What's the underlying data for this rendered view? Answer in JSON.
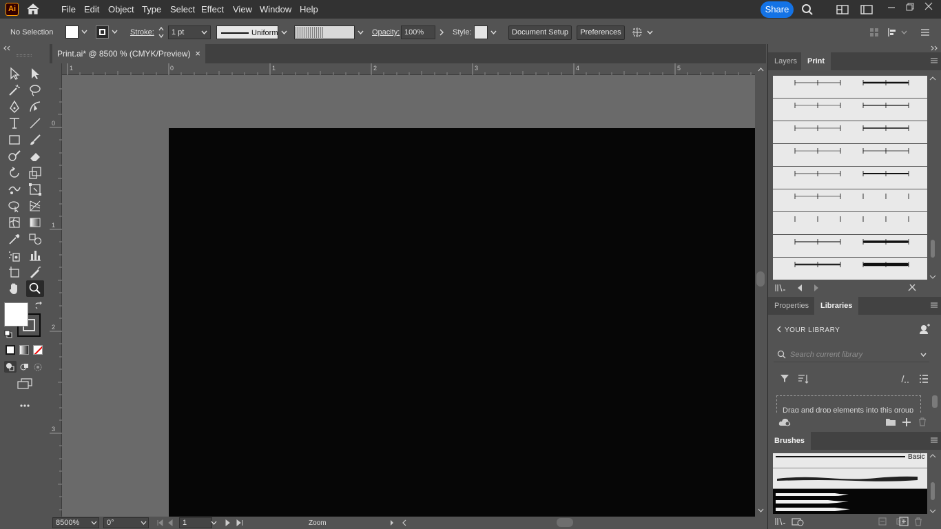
{
  "app": {
    "logo_text": "Ai",
    "menus": [
      "File",
      "Edit",
      "Object",
      "Type",
      "Select",
      "Effect",
      "View",
      "Window",
      "Help"
    ],
    "share_label": "Share"
  },
  "control_bar": {
    "selection_status": "No Selection",
    "stroke_label": "Stroke:",
    "stroke_weight": "1 pt",
    "stroke_profile": "Uniform",
    "opacity_label": "Opacity:",
    "opacity_value": "100%",
    "style_label": "Style:",
    "document_setup_label": "Document Setup",
    "preferences_label": "Preferences"
  },
  "document": {
    "tab_title": "Print.ai* @ 8500 % (CMYK/Preview)",
    "close_glyph": "×"
  },
  "rulers": {
    "top_labels": [
      "1",
      "0",
      "1",
      "2",
      "3",
      "4",
      "5"
    ],
    "left_labels": [
      "0",
      "1",
      "2",
      "3"
    ]
  },
  "status_bar": {
    "zoom_value": "8500%",
    "rotation_value": "0°",
    "artboard_number": "1",
    "status_text": "Zoom"
  },
  "panels": {
    "top_tabs": [
      "Layers",
      "Print"
    ],
    "mid_tabs": [
      "Properties",
      "Libraries"
    ],
    "library": {
      "back_label": "YOUR LIBRARY",
      "search_placeholder": "Search current library",
      "dropzone_text": "Drag and drop elements into this group"
    },
    "brushes_tab": "Brushes",
    "brush_basic_label": "Basic"
  },
  "colors": {
    "accent": "#1473e6",
    "artboard": "#060606",
    "pasteboard": "#6a6a6a",
    "ui_bg": "#535353",
    "menubar": "#323232"
  }
}
